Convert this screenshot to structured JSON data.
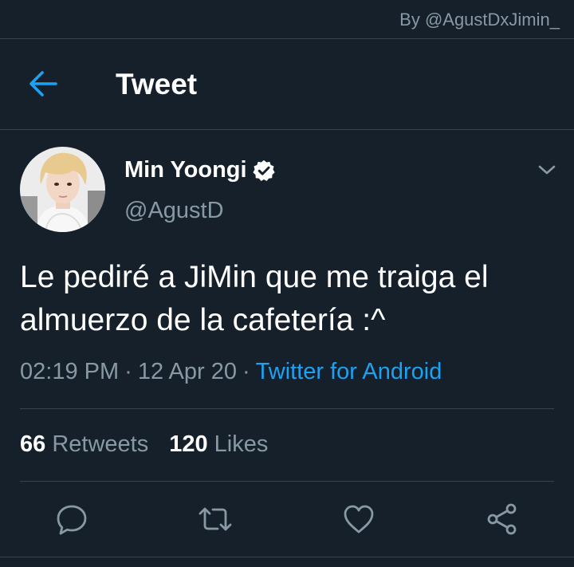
{
  "credit": "By @AgustDxJimin_",
  "header": {
    "title": "Tweet",
    "back_icon": "arrow-left-icon"
  },
  "tweet": {
    "author_name": "Min Yoongi",
    "author_handle": "@AgustD",
    "verified": true,
    "text_lines": [
      "Le pediré a JiMin que me traiga el",
      "almuerzo de la cafetería :^"
    ],
    "time": "02:19 PM",
    "date": "12 Apr 20",
    "separator": "·",
    "source": "Twitter for Android"
  },
  "stats": {
    "retweets_count": "66",
    "retweets_label": "Retweets",
    "likes_count": "120",
    "likes_label": "Likes"
  },
  "actions": [
    "reply-icon",
    "retweet-icon",
    "like-icon",
    "share-icon"
  ],
  "colors": {
    "background": "#15202b",
    "divider": "#38444d",
    "secondary_text": "#8899a6",
    "accent": "#1da1f2"
  }
}
